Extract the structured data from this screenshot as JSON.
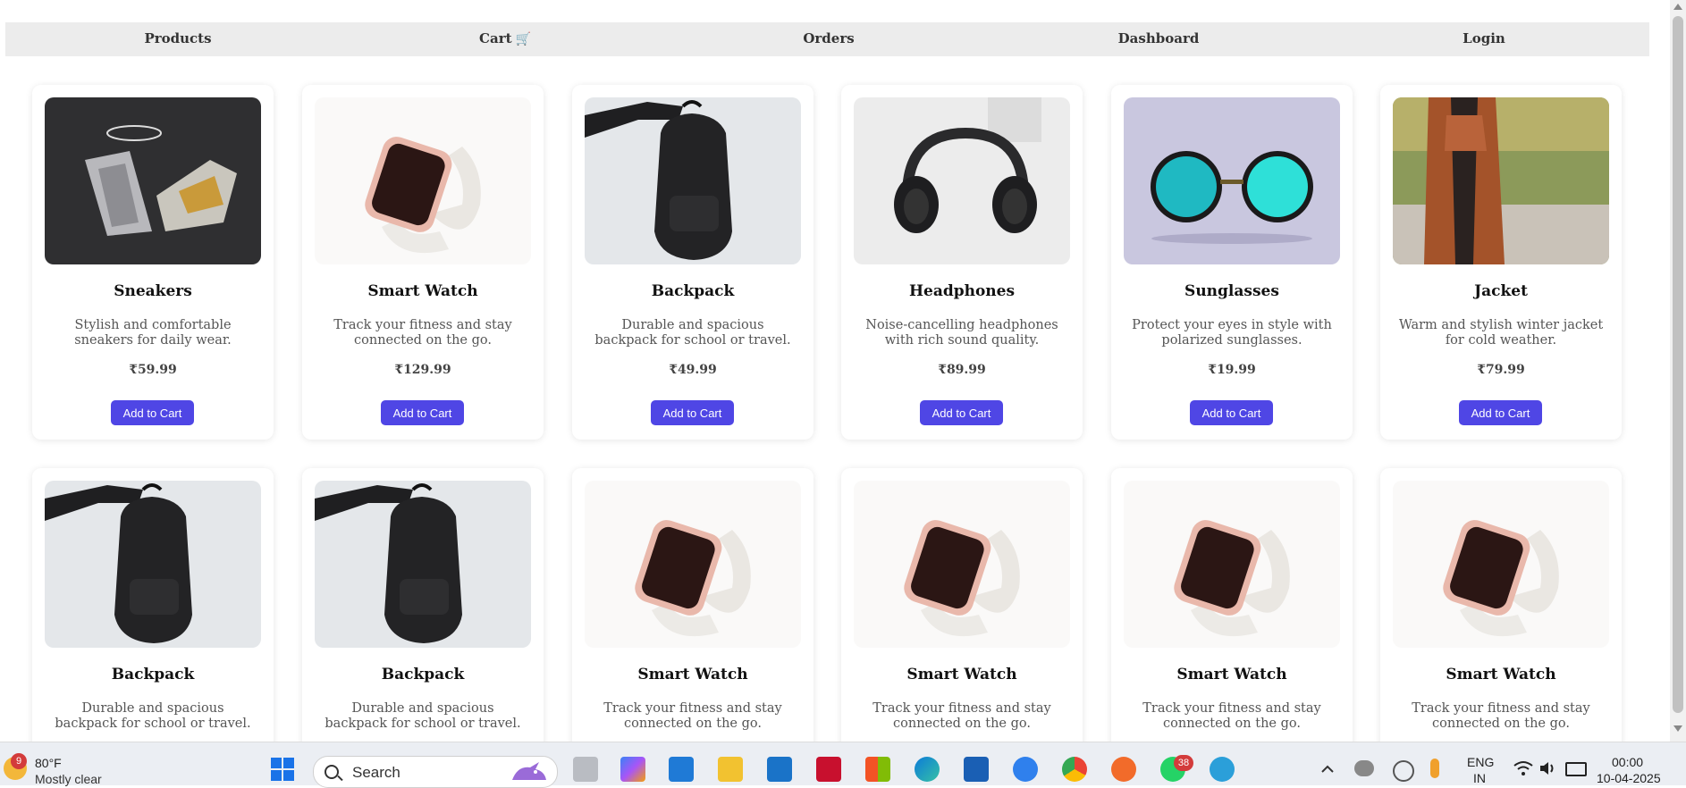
{
  "nav": {
    "products": "Products",
    "cart": "Cart",
    "cart_icon": "🛒",
    "orders": "Orders",
    "dashboard": "Dashboard",
    "login": "Login"
  },
  "products": [
    {
      "name": "Sneakers",
      "desc": "Stylish and comfortable sneakers for daily wear.",
      "price": "₹59.99",
      "button": "Add to Cart",
      "image": "sneakers"
    },
    {
      "name": "Smart Watch",
      "desc": "Track your fitness and stay connected on the go.",
      "price": "₹129.99",
      "button": "Add to Cart",
      "image": "smart-watch"
    },
    {
      "name": "Backpack",
      "desc": "Durable and spacious backpack for school or travel.",
      "price": "₹49.99",
      "button": "Add to Cart",
      "image": "backpack"
    },
    {
      "name": "Headphones",
      "desc": "Noise-cancelling headphones with rich sound quality.",
      "price": "₹89.99",
      "button": "Add to Cart",
      "image": "headphones"
    },
    {
      "name": "Sunglasses",
      "desc": "Protect your eyes in style with polarized sunglasses.",
      "price": "₹19.99",
      "button": "Add to Cart",
      "image": "sunglasses"
    },
    {
      "name": "Jacket",
      "desc": "Warm and stylish winter jacket for cold weather.",
      "price": "₹79.99",
      "button": "Add to Cart",
      "image": "jacket"
    },
    {
      "name": "Backpack",
      "desc": "Durable and spacious backpack for school or travel.",
      "image": "backpack"
    },
    {
      "name": "Backpack",
      "desc": "Durable and spacious backpack for school or travel.",
      "image": "backpack"
    },
    {
      "name": "Smart Watch",
      "desc": "Track your fitness and stay connected on the go.",
      "image": "smart-watch"
    },
    {
      "name": "Smart Watch",
      "desc": "Track your fitness and stay connected on the go.",
      "image": "smart-watch"
    },
    {
      "name": "Smart Watch",
      "desc": "Track your fitness and stay connected on the go.",
      "image": "smart-watch"
    },
    {
      "name": "Smart Watch",
      "desc": "Track your fitness and stay connected on the go.",
      "image": "smart-watch"
    }
  ],
  "taskbar": {
    "weather_badge": "9",
    "weather_temp": "80°F",
    "weather_desc": "Mostly clear",
    "search_label": "Search",
    "whatsapp_badge": "38",
    "lang_top": "ENG",
    "lang_bottom": "IN",
    "time": "00:00",
    "date": "10-04-2025",
    "apps": [
      "windows-start-icon",
      "task-view-icon",
      "copilot-icon",
      "vscode-icon",
      "file-explorer-icon",
      "myhp-icon",
      "mcafee-icon",
      "microsoft-store-icon",
      "edge-icon",
      "app-icon",
      "help-icon",
      "chrome-icon",
      "pen-app-icon",
      "whatsapp-icon",
      "people-icon"
    ]
  },
  "colors": {
    "accent": "#4f46e5",
    "nav_bg": "#ececec",
    "taskbar_bg": "#ebeef3"
  }
}
